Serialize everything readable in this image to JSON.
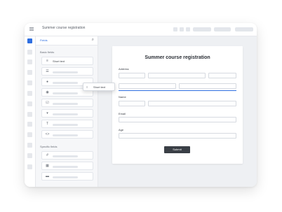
{
  "window": {
    "title": "Summer course registration"
  },
  "sidebar": {
    "tab_label": "Fields",
    "search_icon": "search-icon",
    "basic_section": "Basic fields",
    "specific_section": "Specific fields",
    "basic_items": [
      {
        "icon": "text-lines-icon",
        "label": "Short text"
      },
      {
        "icon": "paragraph-icon",
        "label": ""
      },
      {
        "icon": "radio-icon",
        "label": ""
      },
      {
        "icon": "radio-selected-icon",
        "label": ""
      },
      {
        "icon": "checkbox-icon",
        "label": ""
      },
      {
        "icon": "dropdown-icon",
        "label": ""
      },
      {
        "icon": "heading-icon",
        "label": ""
      },
      {
        "icon": "code-icon",
        "label": ""
      }
    ],
    "specific_items": [
      {
        "icon": "number-icon",
        "label": ""
      },
      {
        "icon": "grid-icon",
        "label": ""
      },
      {
        "icon": "card-icon",
        "label": ""
      }
    ]
  },
  "drag_ghost": {
    "label": "Short text"
  },
  "form": {
    "title": "Summer course registration",
    "labels": {
      "address": "Address",
      "name": "Name",
      "email": "Email",
      "age": "Age"
    },
    "submit_label": "Submit"
  },
  "colors": {
    "accent": "#2f6fe0",
    "submit_bg": "#3a3f46"
  }
}
